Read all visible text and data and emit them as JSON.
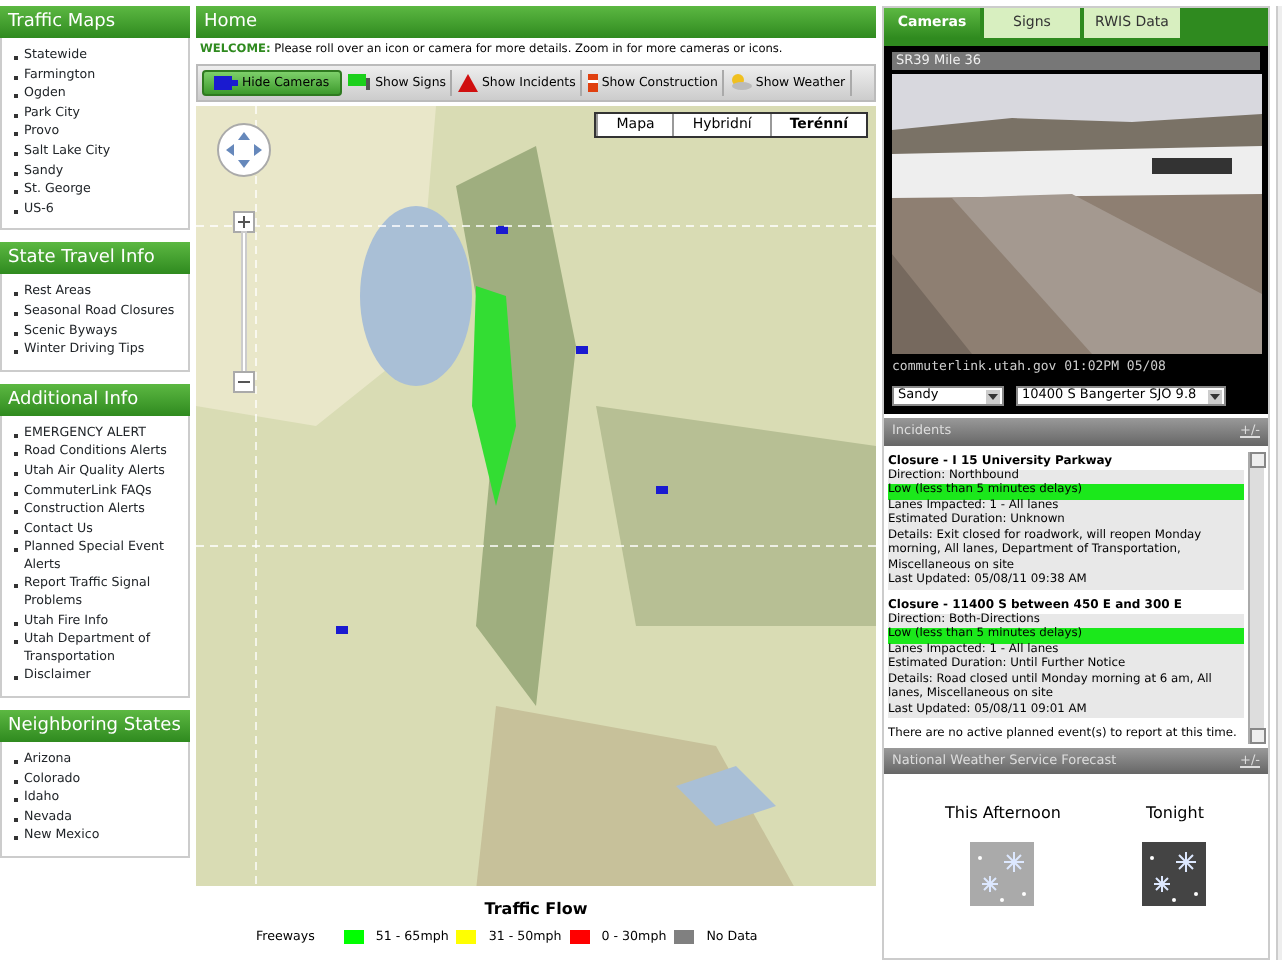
{
  "sidebar": [
    {
      "title": "Traffic Maps",
      "items": [
        "Statewide",
        "Farmington",
        "Ogden",
        "Park City",
        "Provo",
        "Salt Lake City",
        "Sandy",
        "St. George",
        "US-6"
      ]
    },
    {
      "title": "State Travel Info",
      "items": [
        "Rest Areas",
        "Seasonal Road Closures",
        "Scenic Byways",
        "Winter Driving Tips"
      ]
    },
    {
      "title": "Additional Info",
      "items": [
        "EMERGENCY ALERT",
        "Road Conditions Alerts",
        "Utah Air Quality Alerts",
        "CommuterLink FAQs",
        "Construction Alerts",
        "Contact Us",
        "Planned Special Event Alerts",
        "Report Traffic Signal Problems",
        "Utah Fire Info",
        "Utah Department of Transportation",
        "Disclaimer"
      ]
    },
    {
      "title": "Neighboring States",
      "items": [
        "Arizona",
        "Colorado",
        "Idaho",
        "Nevada",
        "New Mexico"
      ]
    }
  ],
  "main": {
    "title": "Home",
    "welcome_label": "WELCOME:",
    "welcome_text": "Please roll over an icon or camera for more details. Zoom in for more cameras or icons.",
    "toolbar": [
      {
        "label": "Hide Cameras",
        "kind": "camera",
        "selected": true
      },
      {
        "label": "Show Signs",
        "kind": "sign",
        "selected": false
      },
      {
        "label": "Show Incidents",
        "kind": "incident",
        "selected": false
      },
      {
        "label": "Show Construction",
        "kind": "construction",
        "selected": false
      },
      {
        "label": "Show Weather",
        "kind": "weather",
        "selected": false
      }
    ],
    "map_types": [
      {
        "label": "Mapa",
        "selected": false
      },
      {
        "label": "Hybridní",
        "selected": false
      },
      {
        "label": "Terénní",
        "selected": true
      }
    ],
    "legend": {
      "title": "Traffic Flow",
      "row_label": "Freeways",
      "items": [
        {
          "label": "51 - 65mph",
          "color": "#00ff00"
        },
        {
          "label": "31 - 50mph",
          "color": "#ffff00"
        },
        {
          "label": "0 - 30mph",
          "color": "#ff0000"
        },
        {
          "label": "No Data",
          "color": "#808080"
        }
      ]
    }
  },
  "right": {
    "tabs": [
      {
        "label": "Cameras",
        "selected": true
      },
      {
        "label": "Signs",
        "selected": false
      },
      {
        "label": "RWIS Data",
        "selected": false
      }
    ],
    "camera": {
      "title": "SR39 Mile 36",
      "caption": "commuterlink.utah.gov 01:02PM 05/08",
      "area": "Sandy",
      "location": "10400 S Bangerter SJO 9.8"
    },
    "incidents": {
      "title": "Incidents",
      "toggle": "+/-",
      "items": [
        {
          "title": "Closure - I 15 University Parkway",
          "direction": "Direction: Northbound",
          "delay": "Low (less than 5 minutes delays)",
          "lines": [
            "Lanes Impacted: 1 - All lanes",
            "Estimated Duration: Unknown",
            "Details: Exit closed for roadwork, will reopen Monday morning, All lanes, Department of Transportation, Miscellaneous on site",
            "Last Updated: 05/08/11 09:38 AM"
          ]
        },
        {
          "title": "Closure - 11400 S between 450 E and 300 E",
          "direction": "Direction: Both-Directions",
          "delay": "Low (less than 5 minutes delays)",
          "lines": [
            "Lanes Impacted: 1 - All lanes",
            "Estimated Duration: Until Further Notice",
            "Details: Road closed until Monday morning at 6 am, All lanes, Miscellaneous on site",
            "Last Updated: 05/08/11 09:01 AM"
          ]
        }
      ],
      "note": "There are no active planned event(s) to report at this time."
    },
    "forecast": {
      "title": "National Weather Service Forecast",
      "toggle": "+/-",
      "periods": [
        {
          "label": "This Afternoon",
          "kind": "light"
        },
        {
          "label": "Tonight",
          "kind": "dark"
        }
      ]
    }
  }
}
